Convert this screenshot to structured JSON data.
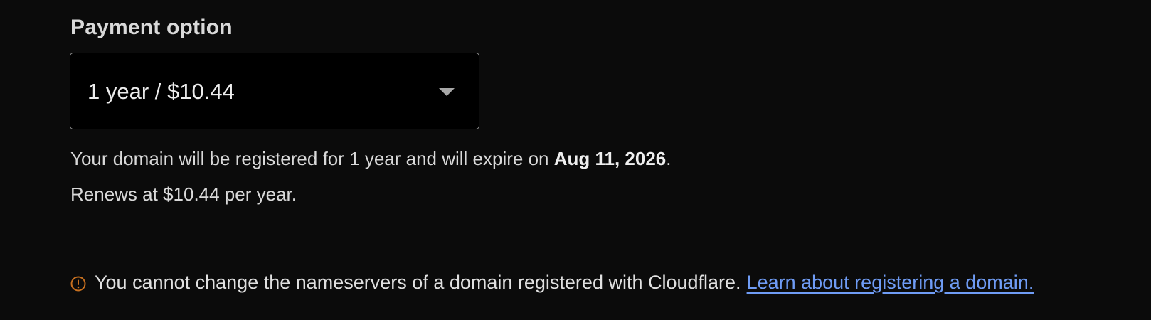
{
  "payment": {
    "label": "Payment option",
    "selected": "1 year / $10.44"
  },
  "details": {
    "registration_prefix": "Your domain will be registered for 1 year and will expire on ",
    "expiry_date": "Aug 11, 2026",
    "registration_suffix": ".",
    "renewal": "Renews at $10.44 per year."
  },
  "notice": {
    "icon": "warning-circle-icon",
    "icon_color": "#c8701f",
    "text": "You cannot change the nameservers of a domain registered with Cloudflare.",
    "link_text": "Learn about registering a domain.",
    "link_color": "#6f9cf5"
  }
}
